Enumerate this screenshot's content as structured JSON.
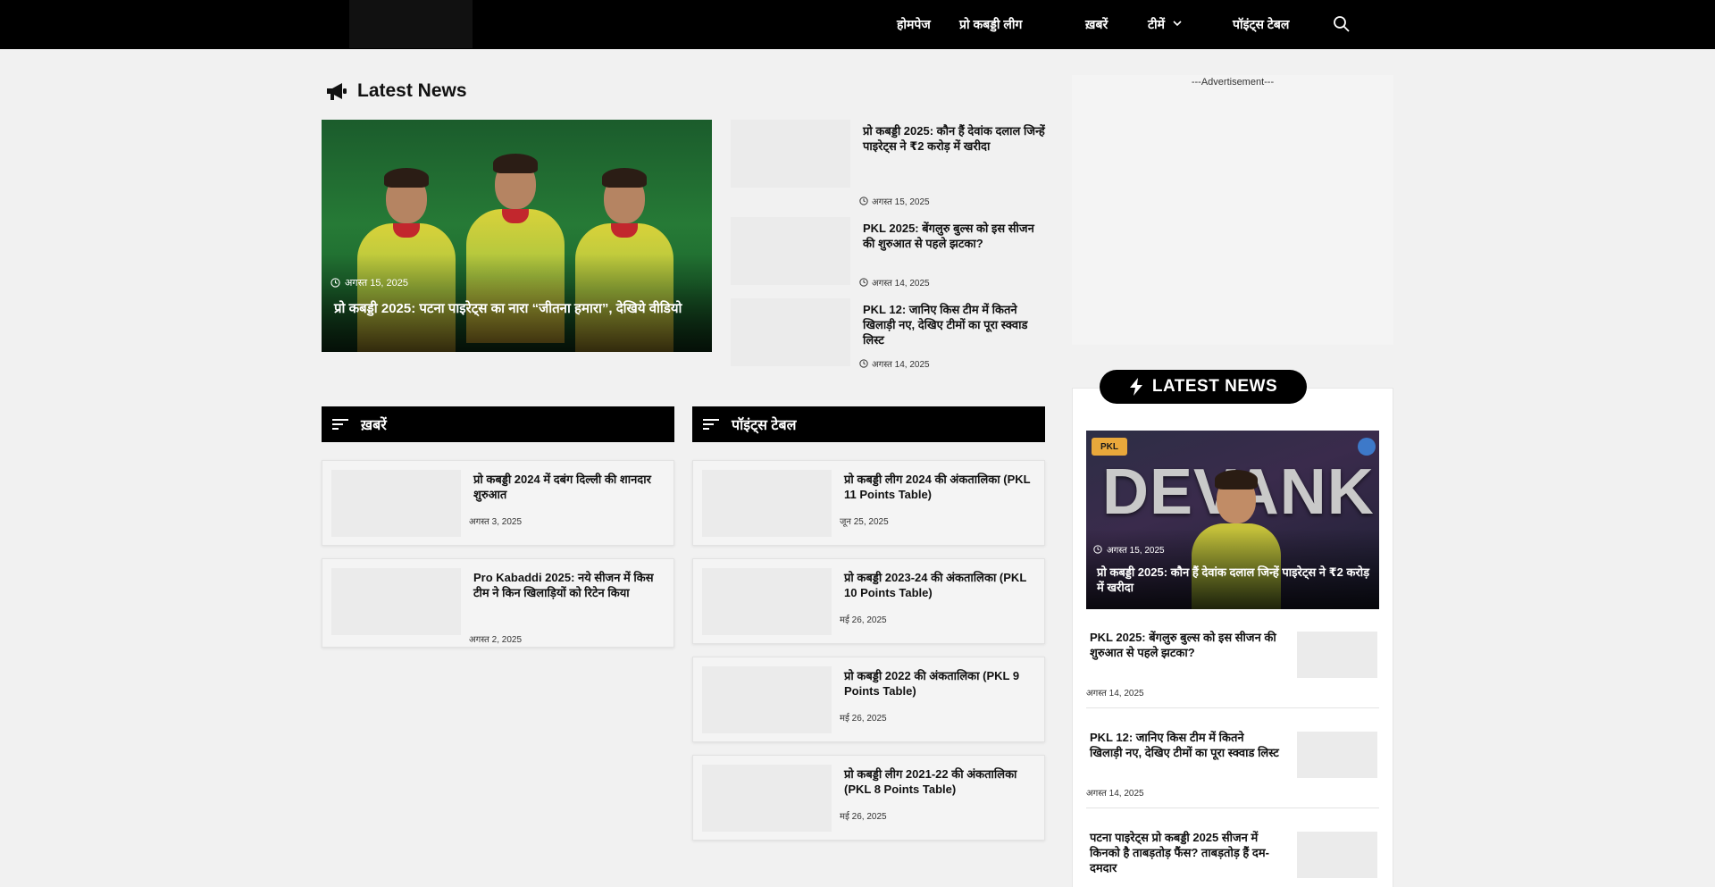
{
  "header": {
    "nav": [
      {
        "label": "होमपेज"
      },
      {
        "label": "प्रो कबड्डी लीग"
      },
      {
        "label": "ख़बरें"
      },
      {
        "label": "टीमें"
      },
      {
        "label": "पॉइंट्स टेबल"
      }
    ]
  },
  "latest": {
    "title": "Latest News",
    "featured": {
      "date": "अगस्त 15, 2025",
      "title": "प्रो कबड्डी 2025: पटना पाइरेट्स का नारा “जीतना हमारा”, देखिये वीडियो"
    },
    "list": [
      {
        "title": "प्रो कबड्डी 2025: कौन हैं देवांक दलाल जिन्हें पाइरेट्स ने ₹2 करोड़ में खरीदा",
        "date": "अगस्त 15, 2025"
      },
      {
        "title": "PKL 2025: बेंगलुरु बुल्स को इस सीजन की शुरुआत से पहले झटका?",
        "date": "अगस्त 14, 2025"
      },
      {
        "title": "PKL 12: जानिए किस टीम में कितने खिलाड़ी नए, देखिए टीमों का पूरा स्क्वाड लिस्ट",
        "date": "अगस्त 14, 2025"
      }
    ]
  },
  "categories": [
    {
      "title": "ख़बरें",
      "items": [
        {
          "title": "प्रो कबड्डी 2024 में दबंग दिल्ली की शानदार शुरुआत",
          "date": "अगस्त 3, 2025"
        },
        {
          "title": "Pro Kabaddi 2025: नये सीजन में किस टीम ने किन खिलाड़ियों को रिटेन किया",
          "date": "अगस्त 2, 2025"
        }
      ]
    },
    {
      "title": "पॉइंट्स टेबल",
      "items": [
        {
          "title": "प्रो कबड्डी लीग 2024 की अंकतालिका (PKL 11 Points Table)",
          "date": "जून 25, 2025"
        },
        {
          "title": "प्रो कबड्डी 2023-24 की अंकतालिका (PKL 10 Points Table)",
          "date": "मई 26, 2025"
        },
        {
          "title": "प्रो कबड्डी 2022 की अंकतालिका (PKL 9 Points Table)",
          "date": "मई 26, 2025"
        },
        {
          "title": "प्रो कबड्डी लीग 2021-22 की अंकतालिका (PKL 8 Points Table)",
          "date": "मई 26, 2025"
        }
      ]
    }
  ],
  "sidebar": {
    "ad_label": "---Advertisement---",
    "pill_title": "LATEST NEWS",
    "hero": {
      "badge": "PKL",
      "word": "DEVANK",
      "date": "अगस्त 15, 2025",
      "title": "प्रो कबड्डी 2025: कौन हैं देवांक दलाल जिन्हें पाइरेट्स ने ₹2 करोड़ में खरीदा"
    },
    "items": [
      {
        "title": "PKL 2025: बेंगलुरु बुल्स को इस सीजन की शुरुआत से पहले झटका?",
        "date": "अगस्त 14, 2025"
      },
      {
        "title": "PKL 12: जानिए किस टीम में कितने खिलाड़ी नए, देखिए टीमों का पूरा स्क्वाड लिस्ट",
        "date": "अगस्त 14, 2025"
      },
      {
        "title": "पटना पाइरेट्स प्रो कबड्डी 2025 सीजन में किनको है ताबड़तोड़ फैंस? ताबड़तोड़ हैं दम-दमदार",
        "date": ""
      }
    ]
  },
  "colors": {
    "header_bg": "#000000",
    "page_bg": "#f1f1f1",
    "card_bg": "#f4f4f4"
  },
  "icons": {
    "megaphone": "megaphone-icon",
    "search": "search-icon",
    "clock": "clock-icon",
    "sort": "sort-lines-icon",
    "bolt": "lightning-icon"
  }
}
